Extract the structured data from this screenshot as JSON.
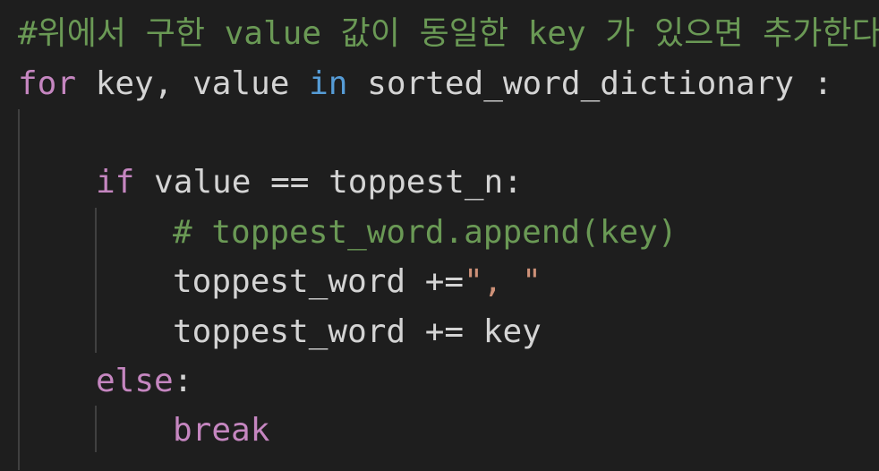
{
  "code": {
    "line1": {
      "comment": "#위에서 구한 value 값이 동일한 key 가 있으면 추가한다"
    },
    "line2": {
      "kw_for": "for",
      "vars": " key, value ",
      "kw_in": "in",
      "rest": " sorted_word_dictionary :"
    },
    "line4": {
      "kw_if": "if",
      "rest": " value == toppest_n:"
    },
    "line5": {
      "comment": "# toppest_word.append(key)"
    },
    "line6": {
      "lhs": "toppest_word +=",
      "str": "\", \""
    },
    "line7": {
      "text": "toppest_word += key"
    },
    "line8": {
      "kw_else": "else",
      "colon": ":"
    },
    "line9": {
      "kw_break": "break"
    }
  },
  "colors": {
    "background": "#1e1e1e",
    "comment": "#6a9955",
    "control_keyword": "#c586c0",
    "keyword": "#569cd6",
    "string": "#ce9178",
    "text": "#d4d4d4"
  }
}
